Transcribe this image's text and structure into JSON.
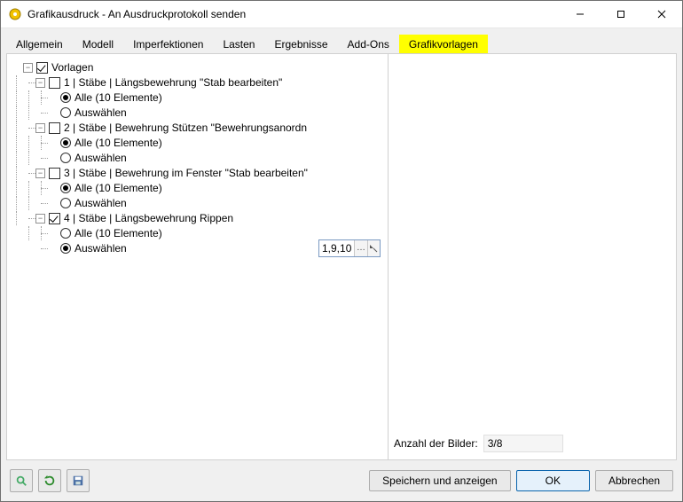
{
  "window": {
    "title": "Grafikausdruck - An Ausdruckprotokoll senden"
  },
  "tabs": {
    "items": [
      {
        "label": "Allgemein"
      },
      {
        "label": "Modell"
      },
      {
        "label": "Imperfektionen"
      },
      {
        "label": "Lasten"
      },
      {
        "label": "Ergebnisse"
      },
      {
        "label": "Add-Ons"
      },
      {
        "label": "Grafikvorlagen"
      }
    ],
    "active_index": 6
  },
  "tree": {
    "root": {
      "label": "Vorlagen",
      "checked": true
    },
    "items": [
      {
        "label": "1 | Stäbe | Längsbewehrung \"Stab bearbeiten\"",
        "checked": false,
        "options": {
          "all": "Alle (10 Elemente)",
          "select": "Auswählen",
          "selected": "all"
        }
      },
      {
        "label": "2 | Stäbe | Bewehrung Stützen \"Bewehrungsanordn",
        "checked": false,
        "options": {
          "all": "Alle (10 Elemente)",
          "select": "Auswählen",
          "selected": "all"
        }
      },
      {
        "label": "3 | Stäbe | Bewehrung im Fenster \"Stab bearbeiten\"",
        "checked": false,
        "options": {
          "all": "Alle (10 Elemente)",
          "select": "Auswählen",
          "selected": "all"
        }
      },
      {
        "label": "4 | Stäbe | Längsbewehrung Rippen",
        "checked": true,
        "options": {
          "all": "Alle (10 Elemente)",
          "select": "Auswählen",
          "selected": "select"
        }
      }
    ],
    "selection_value": "1,9,10"
  },
  "right": {
    "count_label": "Anzahl der Bilder:",
    "count_value": "3/8"
  },
  "footer": {
    "save_show": "Speichern und anzeigen",
    "ok": "OK",
    "cancel": "Abbrechen"
  },
  "icons": {
    "search": "search-icon",
    "refresh": "refresh-icon",
    "save": "save-icon"
  }
}
